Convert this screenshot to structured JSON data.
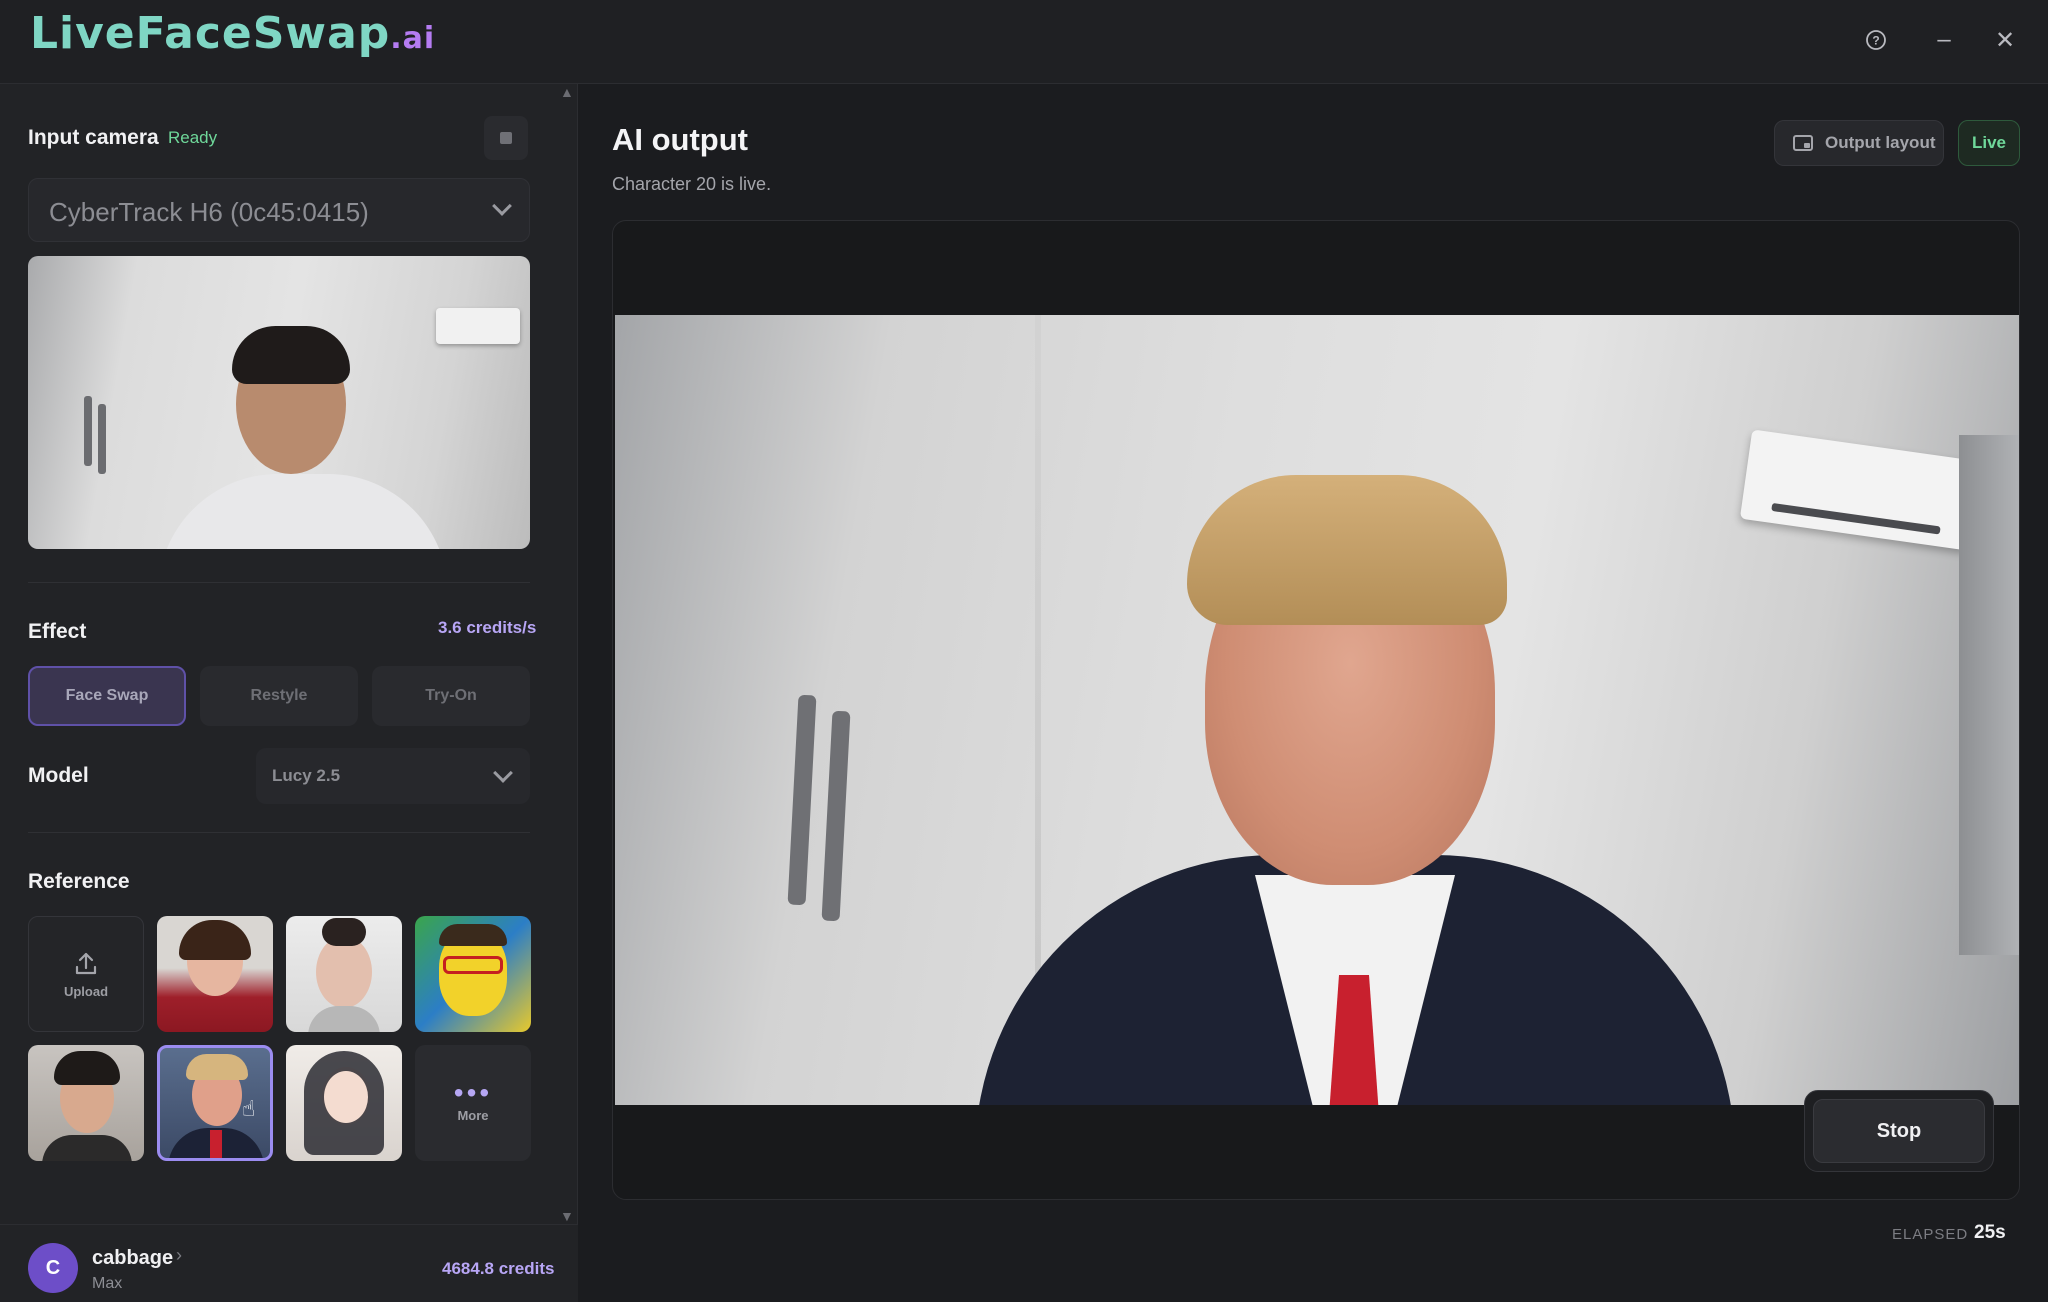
{
  "app": {
    "logo_main": "LiveFaceSwap",
    "logo_suffix": ".ai"
  },
  "window_controls": {
    "help_icon": "?",
    "minimize_icon": "–",
    "close_icon": "✕"
  },
  "input_camera": {
    "title": "Input camera",
    "status": "Ready",
    "device": "CyberTrack H6 (0c45:0415)"
  },
  "effect": {
    "title": "Effect",
    "credits_rate": "3.6 credits/s",
    "tabs": [
      {
        "label": "Face Swap",
        "active": true
      },
      {
        "label": "Restyle",
        "active": false
      },
      {
        "label": "Try-On",
        "active": false
      }
    ]
  },
  "model": {
    "title": "Model",
    "value": "Lucy 2.5"
  },
  "reference": {
    "title": "Reference",
    "upload_label": "Upload",
    "more_label": "More",
    "more_icon": "•••",
    "selected_index": 5
  },
  "user": {
    "initial": "C",
    "name": "cabbage",
    "plan": "Max",
    "chevron": "›",
    "credits": "4684.8 credits"
  },
  "output": {
    "title": "AI output",
    "subtitle": "Character 20 is live.",
    "layout_button": "Output layout",
    "live_badge": "Live",
    "stop_button": "Stop",
    "elapsed_label": "ELAPSED",
    "elapsed_value": "25s"
  },
  "colors": {
    "accent": "#9b8cf0",
    "live_green": "#6fd89a",
    "credits_purple": "#b8a6f5"
  }
}
